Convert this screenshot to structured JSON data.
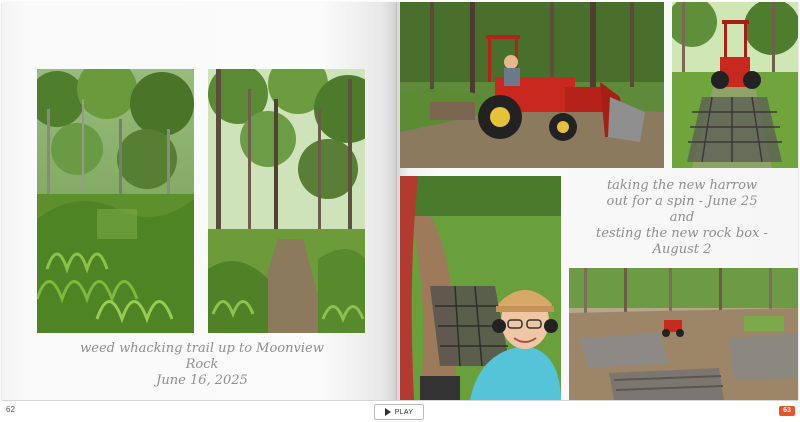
{
  "book": {
    "left_page": {
      "page_number": "62",
      "caption_lines": [
        "weed whacking trail up to Moonview Rock",
        "June 16, 2025"
      ],
      "photos": [
        {
          "name": "forest-trail-ferns-photo"
        },
        {
          "name": "forest-trail-trees-photo"
        }
      ]
    },
    "right_page": {
      "page_number": "63",
      "caption_lines": [
        "taking the new harrow",
        "out for a spin - June 25",
        "and",
        "testing the new rock box -",
        "August 2"
      ],
      "photos": [
        {
          "name": "red-tractor-with-rock-box-photo"
        },
        {
          "name": "tractor-with-harrow-on-trail-photo"
        },
        {
          "name": "selfie-on-tractor-photo"
        },
        {
          "name": "stone-wall-construction-photo"
        }
      ]
    }
  },
  "controls": {
    "play_label": "PLAY"
  },
  "colors": {
    "accent_page_badge": "#e8542b",
    "caption_text": "#8f8f8f",
    "tractor_red": "#c8281e"
  }
}
